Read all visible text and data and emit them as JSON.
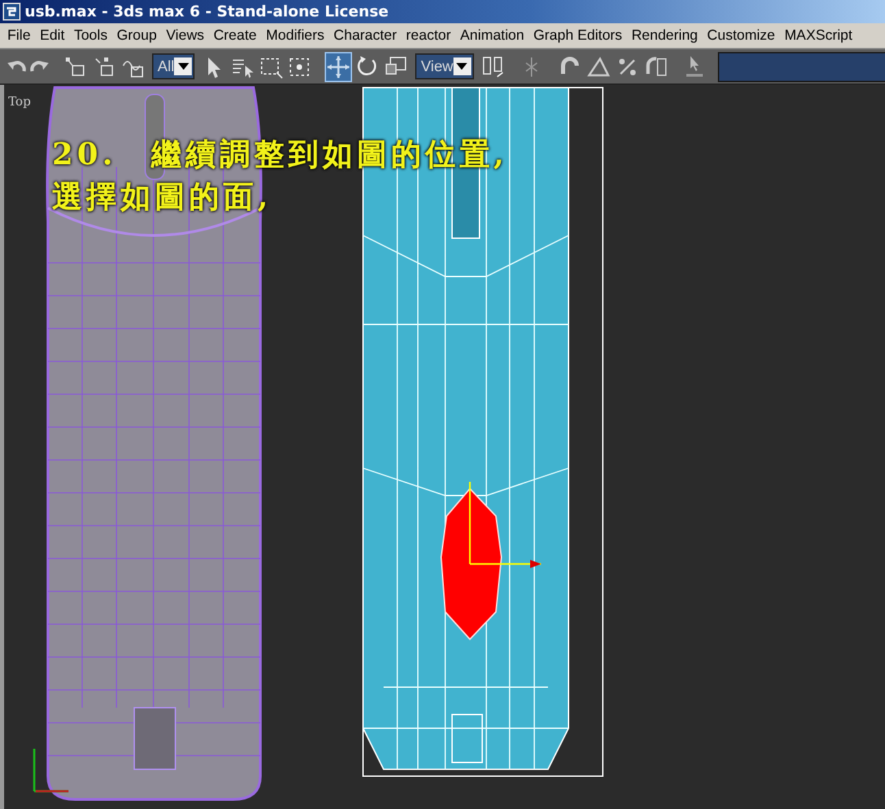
{
  "window": {
    "title": "usb.max - 3ds max 6 - Stand-alone License"
  },
  "menu": [
    "File",
    "Edit",
    "Tools",
    "Group",
    "Views",
    "Create",
    "Modifiers",
    "Character",
    "reactor",
    "Animation",
    "Graph Editors",
    "Rendering",
    "Customize",
    "MAXScript"
  ],
  "toolbar": [
    {
      "kind": "undo",
      "selected": false
    },
    {
      "kind": "redo",
      "selected": false
    },
    {
      "kind": "sep"
    },
    {
      "kind": "link",
      "selected": false
    },
    {
      "kind": "unlink",
      "selected": false
    },
    {
      "kind": "bind",
      "selected": false
    },
    {
      "kind": "dropdown",
      "value": "All"
    },
    {
      "kind": "select",
      "selected": false
    },
    {
      "kind": "select-name",
      "selected": false
    },
    {
      "kind": "region",
      "selected": false
    },
    {
      "kind": "crossing",
      "selected": false
    },
    {
      "kind": "sep"
    },
    {
      "kind": "move",
      "selected": true
    },
    {
      "kind": "rotate",
      "selected": false
    },
    {
      "kind": "scale",
      "selected": false
    },
    {
      "kind": "dropdown",
      "value": "View"
    },
    {
      "kind": "pivot",
      "selected": false
    },
    {
      "kind": "sep"
    },
    {
      "kind": "snap",
      "selected": false
    },
    {
      "kind": "sep"
    },
    {
      "kind": "magnet",
      "selected": false
    },
    {
      "kind": "angle",
      "selected": false
    },
    {
      "kind": "percent",
      "selected": false
    },
    {
      "kind": "spinner",
      "selected": false
    },
    {
      "kind": "sep"
    },
    {
      "kind": "text",
      "selected": false
    },
    {
      "kind": "field"
    }
  ],
  "viewport": {
    "label": "Top",
    "caption": [
      "20.　繼續調整到如圖的位置,",
      "選擇如圖的面,"
    ]
  }
}
